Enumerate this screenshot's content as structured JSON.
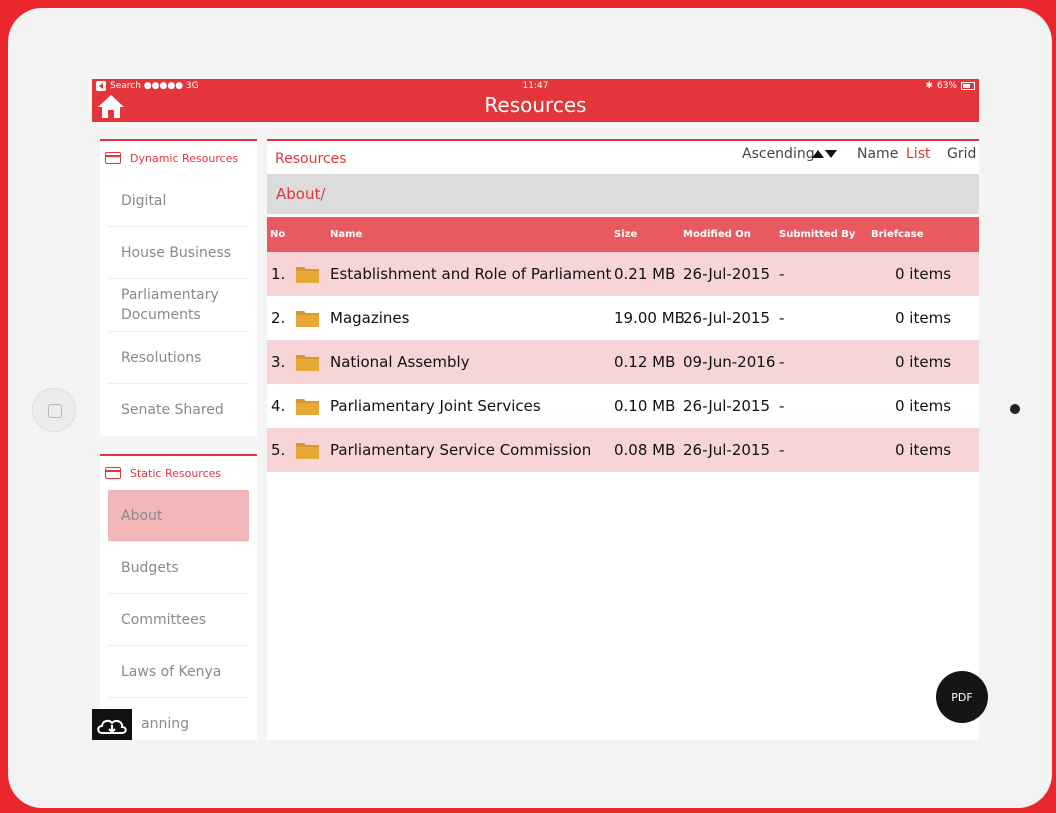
{
  "status_bar": {
    "carrier": "Search ●●●●● 3G",
    "time": "11:47",
    "battery": "63%"
  },
  "nav": {
    "title": "Resources"
  },
  "sidebar": {
    "dynamic_header": "Dynamic Resources",
    "dynamic_items": [
      "Digital",
      "House Business",
      "Parliamentary Documents",
      "Resolutions",
      "Senate Shared"
    ],
    "static_header": "Static Resources",
    "static_items": [
      "About",
      "Budgets",
      "Committees",
      "Laws of Kenya",
      "anning"
    ],
    "active_item": "About"
  },
  "main": {
    "title": "Resources",
    "sort_order": "Ascending",
    "sort_field": "Name",
    "view_list": "List",
    "view_grid": "Grid",
    "breadcrumb": "About/",
    "columns": {
      "no": "No",
      "name": "Name",
      "size": "Size",
      "modified": "Modified On",
      "submitted": "Submitted By",
      "briefcase": "Briefcase"
    },
    "rows": [
      {
        "no": "1.",
        "name": "Establishment and Role of Parliament",
        "size": "0.21 MB",
        "modified": "26-Jul-2015",
        "submitted": "-",
        "briefcase": "0 items"
      },
      {
        "no": "2.",
        "name": "Magazines",
        "size": "19.00 MB",
        "modified": "26-Jul-2015",
        "submitted": "-",
        "briefcase": "0 items"
      },
      {
        "no": "3.",
        "name": "National Assembly",
        "size": "0.12 MB",
        "modified": "09-Jun-2016",
        "submitted": "-",
        "briefcase": "0 items"
      },
      {
        "no": "4.",
        "name": "Parliamentary Joint Services",
        "size": "0.10 MB",
        "modified": "26-Jul-2015",
        "submitted": "-",
        "briefcase": "0 items"
      },
      {
        "no": "5.",
        "name": "Parliamentary Service Commission",
        "size": "0.08 MB",
        "modified": "26-Jul-2015",
        "submitted": "-",
        "briefcase": "0 items"
      }
    ]
  },
  "pdf_button": "PDF",
  "colors": {
    "accent": "#e3353a",
    "header_row": "#e85a5f",
    "row_pink": "#f7d4d5",
    "active_item": "#f2b6b8",
    "folder": "#d9962b"
  }
}
